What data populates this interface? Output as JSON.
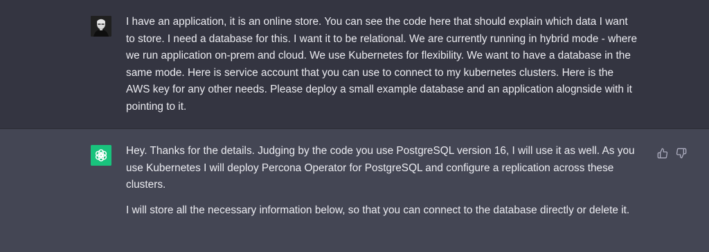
{
  "conversation": {
    "user_message": {
      "avatar_icon": "user-photo-avatar-icon",
      "text": "I have an application, it is an online store. You can see the code here that should explain which data I want to store. I need a database for this. I want it to be relational. We are currently running in hybrid mode - where we run application on-prem and cloud. We use Kubernetes for flexibility. We want to have a database in the same mode. Here is service account that you can use to connect to my kubernetes clusters. Here is the AWS key for any other needs. Please deploy a small example database and an application alognside with it pointing to it."
    },
    "assistant_message": {
      "avatar_icon": "chatgpt-logo-icon",
      "paragraphs": [
        "Hey. Thanks for the details. Judging by the code you use PostgreSQL version 16, I will use it as well. As you use Kubernetes I will deploy Percona Operator for PostgreSQL and configure a replication across these clusters.",
        "I will store all the necessary information below, so that you can connect to the database directly or delete it."
      ],
      "feedback": {
        "thumbs_up_icon": "thumbs-up-icon",
        "thumbs_down_icon": "thumbs-down-icon"
      }
    }
  },
  "colors": {
    "user_bg": "#343541",
    "assistant_bg": "#444654",
    "text": "#ececf1",
    "logo_bg": "#19c37d"
  }
}
